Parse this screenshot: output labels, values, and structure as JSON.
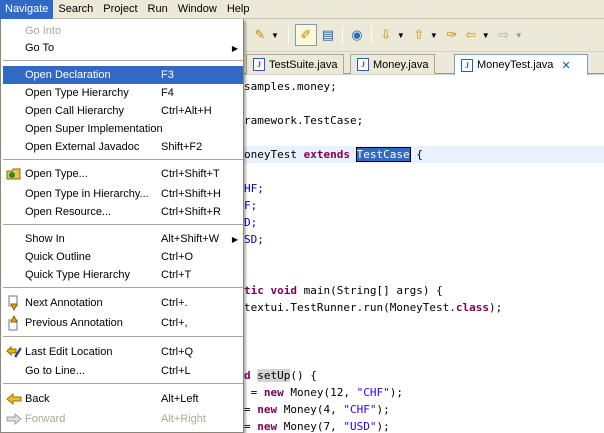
{
  "menubar": {
    "items": [
      "Navigate",
      "Search",
      "Project",
      "Run",
      "Window",
      "Help"
    ]
  },
  "tabs": [
    {
      "label": "TestSuite.java",
      "icon": "java-file-icon"
    },
    {
      "label": "Money.java",
      "icon": "java-file-icon"
    },
    {
      "label": "MoneyTest.java",
      "icon": "java-file-icon",
      "active": true
    }
  ],
  "menu": {
    "items": [
      {
        "label": "Go Into",
        "accel": "",
        "disabled": true
      },
      {
        "label": "Go To",
        "accel": "",
        "submenu": true
      },
      {
        "label": "Open Declaration",
        "accel": "F3",
        "selected": true
      },
      {
        "label": "Open Type Hierarchy",
        "accel": "F4"
      },
      {
        "label": "Open Call Hierarchy",
        "accel": "Ctrl+Alt+H"
      },
      {
        "label": "Open Super Implementation",
        "accel": ""
      },
      {
        "label": "Open External Javadoc",
        "accel": "Shift+F2"
      },
      {
        "label": "Open Type...",
        "accel": "Ctrl+Shift+T",
        "icon": "open-type-icon"
      },
      {
        "label": "Open Type in Hierarchy...",
        "accel": "Ctrl+Shift+H"
      },
      {
        "label": "Open Resource...",
        "accel": "Ctrl+Shift+R"
      },
      {
        "label": "Show In",
        "accel": "Alt+Shift+W",
        "submenu": true
      },
      {
        "label": "Quick Outline",
        "accel": "Ctrl+O"
      },
      {
        "label": "Quick Type Hierarchy",
        "accel": "Ctrl+T"
      },
      {
        "label": "Next Annotation",
        "accel": "Ctrl+.",
        "icon": "next-annotation-icon"
      },
      {
        "label": "Previous Annotation",
        "accel": "Ctrl+,",
        "icon": "previous-annotation-icon"
      },
      {
        "label": "Last Edit Location",
        "accel": "Ctrl+Q",
        "icon": "last-edit-location-icon"
      },
      {
        "label": "Go to Line...",
        "accel": "Ctrl+L"
      },
      {
        "label": "Back",
        "accel": "Alt+Left",
        "icon": "back-arrow-icon"
      },
      {
        "label": "Forward",
        "accel": "Alt+Right",
        "icon": "forward-arrow-icon",
        "disabled": true
      }
    ]
  },
  "code": {
    "l1": "samples.money;",
    "l2": "ramework.TestCase;",
    "l3_a": "oneyTest ",
    "l3_kw": "extends",
    "l3_sel": "TestCase",
    "l3_b": " {",
    "l4": "HF;",
    "l5": "F;",
    "l6": "D;",
    "l7": "SD;",
    "l8_kw1": "tic ",
    "l8_kw2": "void",
    "l8_rest": " main(String[] args) {",
    "l9_a": "textui.TestRunner.run(MoneyTest.",
    "l9_kw": "class",
    "l9_b": ");",
    "l10_kw": "d ",
    "l10_occ": "setUp",
    "l10_b": "() {",
    "l11_a": " = ",
    "l11_kw": "new",
    "l11_b": " Money(12, ",
    "l11_str": "\"CHF\"",
    "l11_c": ");",
    "l12_a": "= ",
    "l12_kw": "new",
    "l12_b": " Money(4, ",
    "l12_str": "\"CHF\"",
    "l12_c": ");",
    "l13_a": "= ",
    "l13_kw": "new",
    "l13_b": " Money(7, ",
    "l13_str": "\"USD\"",
    "l13_c": ");"
  },
  "colors": {
    "menu_highlight": "#316ac5",
    "keyword": "#7f0055",
    "string": "#2a00ff",
    "field": "#0000c0"
  }
}
